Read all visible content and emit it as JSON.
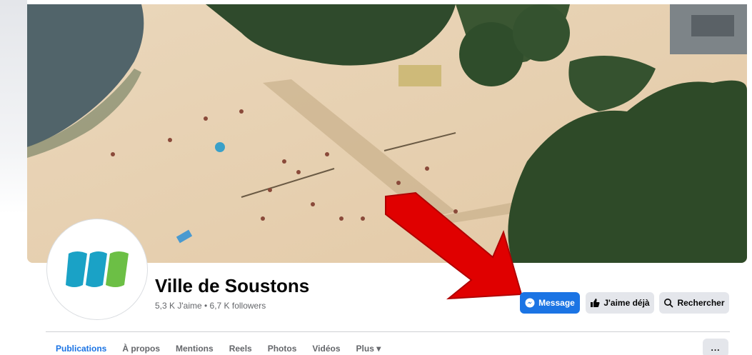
{
  "page": {
    "name": "Ville de Soustons",
    "stats": "5,3 K J'aime • 6,7 K followers"
  },
  "actions": {
    "message_label": "Message",
    "like_label": "J'aime déjà",
    "search_label": "Rechercher"
  },
  "tabs": [
    {
      "label": "Publications",
      "active": true
    },
    {
      "label": "À propos"
    },
    {
      "label": "Mentions"
    },
    {
      "label": "Reels"
    },
    {
      "label": "Photos"
    },
    {
      "label": "Vidéos"
    },
    {
      "label": "Plus"
    }
  ],
  "more_button": "...",
  "icons": {
    "message": "messenger-icon",
    "like": "thumbs-up-icon",
    "search": "magnifier-icon",
    "plus_dropdown": "caret-down-icon"
  },
  "colors": {
    "accent": "#1b74e4",
    "arrow": "#e00000"
  }
}
